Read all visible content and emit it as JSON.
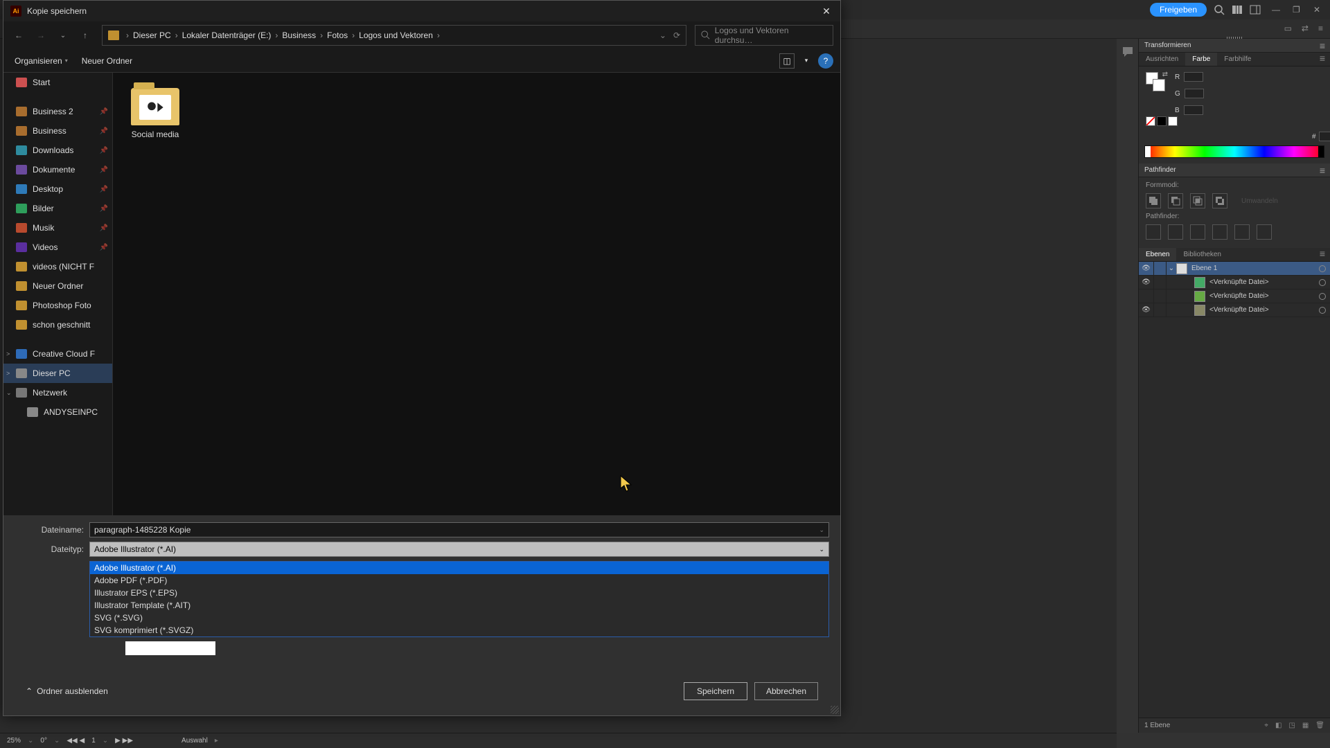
{
  "app_topbar": {
    "share": "Freigeben"
  },
  "dialog": {
    "title": "Kopie speichern",
    "breadcrumb": [
      "Dieser PC",
      "Lokaler Datenträger (E:)",
      "Business",
      "Fotos",
      "Logos und Vektoren"
    ],
    "search_placeholder": "Logos und Vektoren durchsu…",
    "organize": "Organisieren",
    "new_folder": "Neuer Ordner",
    "help_char": "?",
    "sidebar": {
      "start": "Start",
      "items": [
        {
          "label": "Business 2",
          "icon": "ic-fold-b",
          "pin": true
        },
        {
          "label": "Business",
          "icon": "ic-fold-b",
          "pin": true
        },
        {
          "label": "Downloads",
          "icon": "ic-dl",
          "pin": true
        },
        {
          "label": "Dokumente",
          "icon": "ic-doc",
          "pin": true
        },
        {
          "label": "Desktop",
          "icon": "ic-desk",
          "pin": true
        },
        {
          "label": "Bilder",
          "icon": "ic-pic",
          "pin": true
        },
        {
          "label": "Musik",
          "icon": "ic-mus",
          "pin": true
        },
        {
          "label": "Videos",
          "icon": "ic-vid",
          "pin": true
        },
        {
          "label": "videos (NICHT F",
          "icon": "ic-fold",
          "pin": false
        },
        {
          "label": "Neuer Ordner",
          "icon": "ic-fold",
          "pin": false
        },
        {
          "label": "Photoshop Foto",
          "icon": "ic-fold",
          "pin": false
        },
        {
          "label": "schon geschnitt",
          "icon": "ic-fold",
          "pin": false
        }
      ],
      "tree": [
        {
          "label": "Creative Cloud F",
          "icon": "ic-cloud",
          "exp": ">"
        },
        {
          "label": "Dieser PC",
          "icon": "ic-pc",
          "exp": ">"
        },
        {
          "label": "Netzwerk",
          "icon": "ic-net",
          "exp": "⌄"
        },
        {
          "label": "ANDYSEINPC",
          "icon": "ic-pc",
          "exp": ""
        }
      ]
    },
    "files": [
      {
        "name": "Social media"
      }
    ],
    "filename_label": "Dateiname:",
    "filename_value": "paragraph-1485228 Kopie",
    "filetype_label": "Dateityp:",
    "filetype_selected": "Adobe Illustrator (*.AI)",
    "filetype_options": [
      "Adobe Illustrator (*.AI)",
      "Adobe PDF (*.PDF)",
      "Illustrator EPS (*.EPS)",
      "Illustrator Template (*.AIT)",
      "SVG (*.SVG)",
      "SVG komprimiert (*.SVGZ)"
    ],
    "hide_folders": "Ordner ausblenden",
    "save": "Speichern",
    "cancel": "Abbrechen"
  },
  "panels": {
    "transform": "Transformieren",
    "tabs_color": [
      "Ausrichten",
      "Farbe",
      "Farbhilfe"
    ],
    "rgb": {
      "r": "R",
      "g": "G",
      "b": "B",
      "hex": "#"
    },
    "pathfinder": "Pathfinder",
    "pf_formmodi": "Formmodi:",
    "pf_expand": "Umwandeln",
    "pf_pathfinder": "Pathfinder:",
    "tabs_layers": [
      "Ebenen",
      "Bibliotheken"
    ],
    "layer_parent": "Ebene 1",
    "layer_linked": "<Verknüpfte Datei>",
    "layers_count": "1 Ebene"
  },
  "status": {
    "zoom": "25%",
    "rot": "0°",
    "page": "1",
    "sel": "Auswahl"
  }
}
